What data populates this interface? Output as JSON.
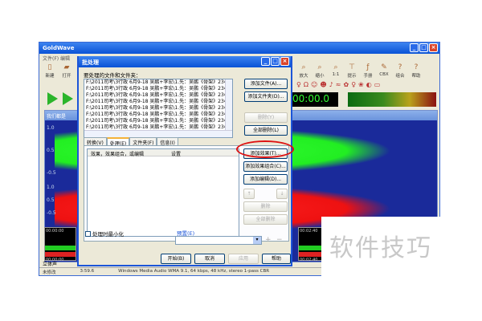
{
  "main": {
    "title": "GoldWave",
    "menu": "文件(F)  编辑",
    "toolbar": [
      "新建",
      "打开"
    ],
    "toolbar_right": [
      "放大",
      "缩小",
      "1:1",
      "提示",
      "手册",
      "CBX",
      "组合",
      "帮助"
    ],
    "time": "00:00.0",
    "wave_title": "我们都是",
    "ticks": [
      "1.0",
      "0.5",
      "-0.5",
      "1.0",
      "0.5",
      "-0.5"
    ],
    "overview_times": [
      "00:00:00",
      "00:00:00"
    ],
    "overview_times_right": [
      "00:02:40",
      "00:02:40"
    ],
    "channel_tab": "立体声",
    "status": {
      "state": "未修改",
      "length": "3:59.6",
      "format": "Windows Media Audio WMA 9.1,  64 kbps, 48 kHz, stereo 1-pass CBR"
    }
  },
  "dialog": {
    "title": "批处理",
    "files_label": "要处理的文件和文件夹：",
    "files": [
      "F:\\2011司考\\3行政 6月9-18 吴鹏+李宏\\1.先：吴鹏《骨架》23小时",
      "F:\\2011司考\\3行政 6月9-18 吴鹏+李宏\\1.先：吴鹏《骨架》23小时",
      "F:\\2011司考\\3行政 6月9-18 吴鹏+李宏\\1.先：吴鹏《骨架》23小时",
      "F:\\2011司考\\3行政 6月9-18 吴鹏+李宏\\1.先：吴鹏《骨架》23小时",
      "F:\\2011司考\\3行政 6月9-18 吴鹏+李宏\\1.先：吴鹏《骨架》23小时",
      "F:\\2011司考\\3行政 6月9-18 吴鹏+李宏\\1.先：吴鹏《骨架》23小时",
      "F:\\2011司考\\3行政 6月9-18 吴鹏+李宏\\1.先：吴鹏《骨架》23小时",
      "F:\\2011司考\\3行政 6月9-18 吴鹏+李宏\\1.先：吴鹏《骨架》23小时"
    ],
    "add_file": "添加文件(A)...",
    "add_folder": "添加文件夹(D)...",
    "remove": "删除(Y)",
    "remove_all": "全部删除(L)",
    "tabs": [
      "转换(V)",
      "处理(E)",
      "文件夹(F)",
      "信息(I)"
    ],
    "columns": [
      "效果，效果组合，或编辑",
      "设置"
    ],
    "add_effect": "添加效果(T)...",
    "add_effect_chain": "添加效果组合(C)...",
    "add_edit": "添加编辑(D)...",
    "up": "↑",
    "down": "↓",
    "delete": "删除",
    "delete_all": "全部删除",
    "minimize_label": "处理时最小化",
    "preset_label": "预置(E)",
    "preset_value": "",
    "start": "开始(B)",
    "cancel": "取消",
    "apply": "应用",
    "help": "帮助"
  },
  "watermark": "软件技巧"
}
